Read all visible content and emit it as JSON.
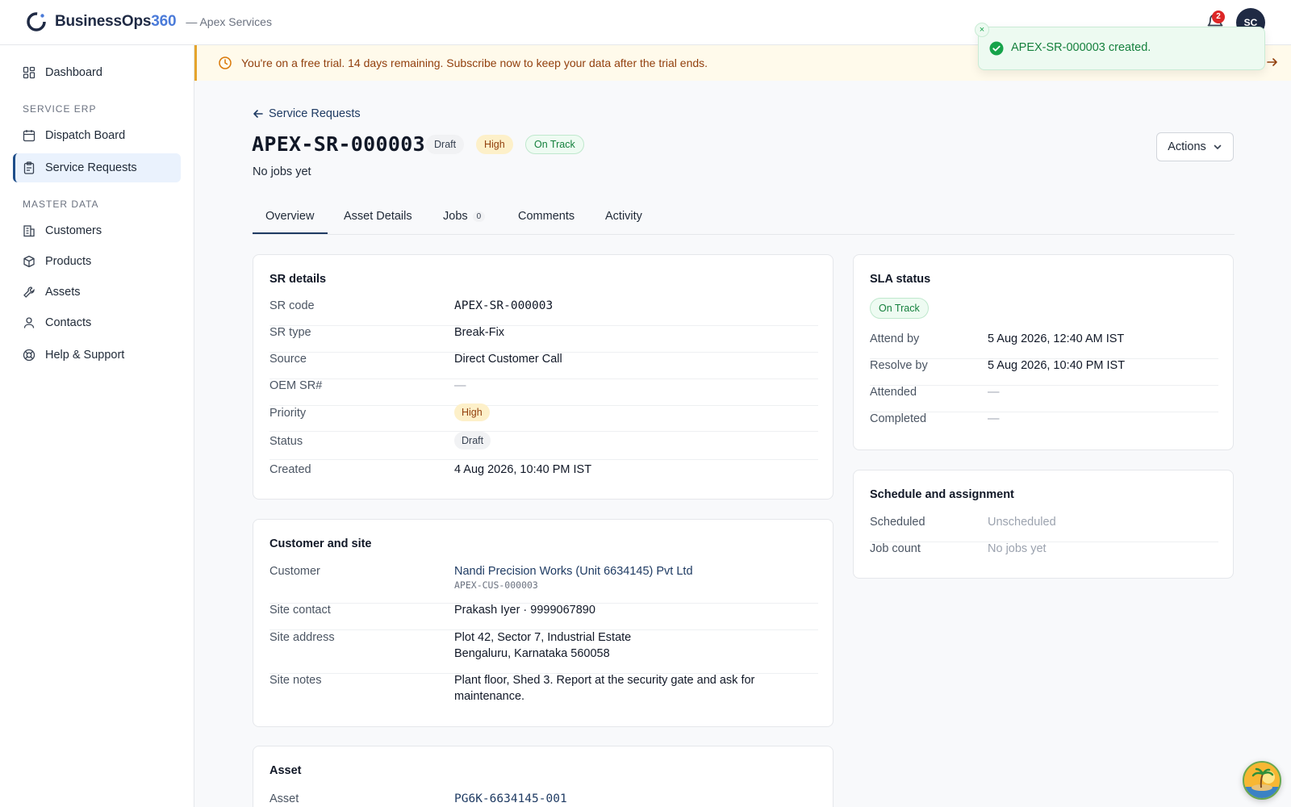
{
  "brand": {
    "name": "BusinessOps",
    "number": "360",
    "tenant": "— Apex Services"
  },
  "header": {
    "notification_count": "2",
    "avatar_initials": "SC"
  },
  "sidebar": {
    "dashboard": "Dashboard",
    "section_service": "SERVICE ERP",
    "dispatch_board": "Dispatch Board",
    "service_requests": "Service Requests",
    "section_master": "MASTER DATA",
    "customers": "Customers",
    "products": "Products",
    "assets": "Assets",
    "contacts": "Contacts",
    "help": "Help & Support"
  },
  "banner": {
    "text": "You're on a free trial. 14 days remaining. Subscribe now to keep your data after the trial ends."
  },
  "toast": {
    "text": "APEX-SR-000003 created.",
    "close": "×"
  },
  "page": {
    "back_label": "Service Requests",
    "title": "APEX-SR-000003",
    "badge_draft": "Draft",
    "badge_high": "High",
    "badge_sla": "On Track",
    "subline": "No jobs yet",
    "actions_label": "Actions"
  },
  "tabs": {
    "overview": "Overview",
    "asset_details": "Asset Details",
    "jobs": "Jobs",
    "jobs_count": "0",
    "comments": "Comments",
    "activity": "Activity"
  },
  "sr_details": {
    "title": "SR details",
    "sr_code_label": "SR code",
    "sr_code": "APEX-SR-000003",
    "sr_type_label": "SR type",
    "sr_type": "Break-Fix",
    "source_label": "Source",
    "source": "Direct Customer Call",
    "oem_label": "OEM SR#",
    "oem": "—",
    "priority_label": "Priority",
    "priority": "High",
    "status_label": "Status",
    "status": "Draft",
    "created_label": "Created",
    "created": "4 Aug 2026, 10:40 PM IST"
  },
  "customer_site": {
    "title": "Customer and site",
    "customer_label": "Customer",
    "customer_name": "Nandi Precision Works (Unit 6634145) Pvt Ltd",
    "customer_code": "APEX-CUS-000003",
    "contact_label": "Site contact",
    "contact": "Prakash Iyer · 9999067890",
    "address_label": "Site address",
    "address_line1": "Plot 42, Sector 7, Industrial Estate",
    "address_line2": "Bengaluru, Karnataka 560058",
    "notes_label": "Site notes",
    "notes_line1": "Plant floor, Shed 3. Report at the security gate and ask for",
    "notes_line2": "maintenance."
  },
  "asset": {
    "title": "Asset",
    "asset_label": "Asset",
    "asset_code": "PG6K-6634145-001"
  },
  "sla": {
    "title": "SLA status",
    "status": "On Track",
    "attend_by_label": "Attend by",
    "attend_by": "5 Aug 2026, 12:40 AM IST",
    "resolve_by_label": "Resolve by",
    "resolve_by": "5 Aug 2026, 10:40 PM IST",
    "attended_label": "Attended",
    "attended": "—",
    "completed_label": "Completed",
    "completed": "—"
  },
  "schedule": {
    "title": "Schedule and assignment",
    "scheduled_label": "Scheduled",
    "scheduled": "Unscheduled",
    "job_count_label": "Job count",
    "job_count": "No jobs yet"
  },
  "colors": {
    "brand_navy": "#1f2a44",
    "brand_accent": "#4b7bd9",
    "success": "#15803d",
    "warning": "#92400e",
    "danger": "#dc2626"
  }
}
